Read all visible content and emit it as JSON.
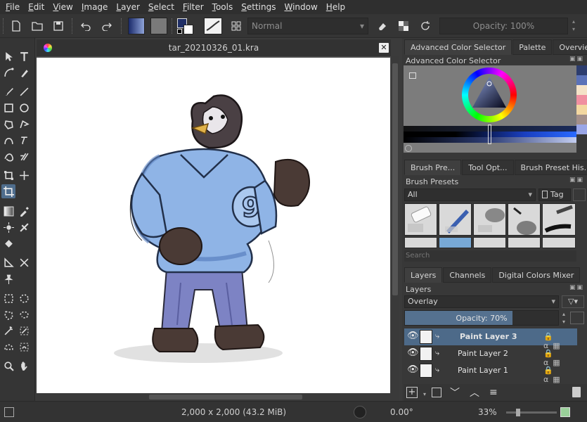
{
  "menubar": {
    "items": [
      "File",
      "Edit",
      "View",
      "Image",
      "Layer",
      "Select",
      "Filter",
      "Tools",
      "Settings",
      "Window",
      "Help"
    ]
  },
  "toolbar": {
    "blend_mode": "Normal",
    "opacity_label": "Opacity: 100%"
  },
  "document": {
    "title": "tar_20210326_01.kra",
    "badge_number": "9"
  },
  "docker": {
    "color_tabs": [
      "Advanced Color Selector",
      "Palette",
      "Overview"
    ],
    "color_panel_title": "Advanced Color Selector",
    "swatch_colors": [
      "#2d3d6e",
      "#5b72b8",
      "#f4e2c7",
      "#f08fa0",
      "#f3d7a0",
      "#a38f8a",
      "#9aa6e6"
    ],
    "brush_tabs": [
      "Brush Pre...",
      "Tool Opt...",
      "Brush Preset His..."
    ],
    "brush_panel_title": "Brush Presets",
    "brush_filter": "All",
    "brush_tag_label": "Tag",
    "brush_search_placeholder": "Search",
    "layer_tabs": [
      "Layers",
      "Channels",
      "Digital Colors Mixer"
    ],
    "layers_panel_title": "Layers",
    "layer_blend_mode": "Overlay",
    "layer_opacity_label": "Opacity:  70%",
    "layer_opacity_value": 0.7,
    "layers": [
      {
        "name": "Paint Layer 3",
        "selected": true
      },
      {
        "name": "Paint Layer 2",
        "selected": false
      },
      {
        "name": "Paint Layer 1",
        "selected": false
      }
    ]
  },
  "statusbar": {
    "image_size": "2,000 x 2,000 (43.2 MiB)",
    "rotation": "0.00°",
    "zoom": "33%"
  },
  "colors": {
    "accent": "#4d6a89",
    "selected_tool": "#4f6d8d",
    "background": "#3b3b3b"
  }
}
